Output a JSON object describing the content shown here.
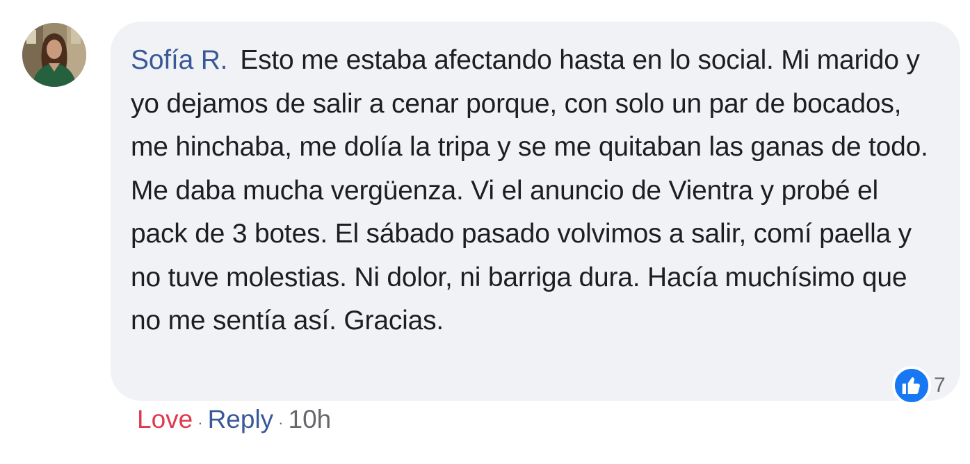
{
  "comment": {
    "author": "Sofía R.",
    "text": "Esto me estaba afectando hasta en lo social. Mi marido y yo dejamos de salir a cenar porque, con solo un par de bocados, me hinchaba, me dolía la tripa y se me quitaban las ganas de todo. Me daba mucha vergüenza. Vi el anuncio de Vientra y probé el pack de 3 botes. El sábado pasado volvimos a salir, comí paella y no tuve molestias. Ni dolor, ni barriga dura. Hacía muchísimo que no me sentía así. Gracias.",
    "reaction_icon": "thumbs-up-icon",
    "reaction_count": "7"
  },
  "actions": {
    "love_label": "Love",
    "separator_1": "·",
    "reply_label": "Reply",
    "separator_2": "·",
    "timestamp": "10h"
  },
  "colors": {
    "bubble_bg": "#f0f2f5",
    "author": "#385898",
    "love": "#e0394f",
    "like": "#1877f2",
    "meta": "#65676b"
  }
}
